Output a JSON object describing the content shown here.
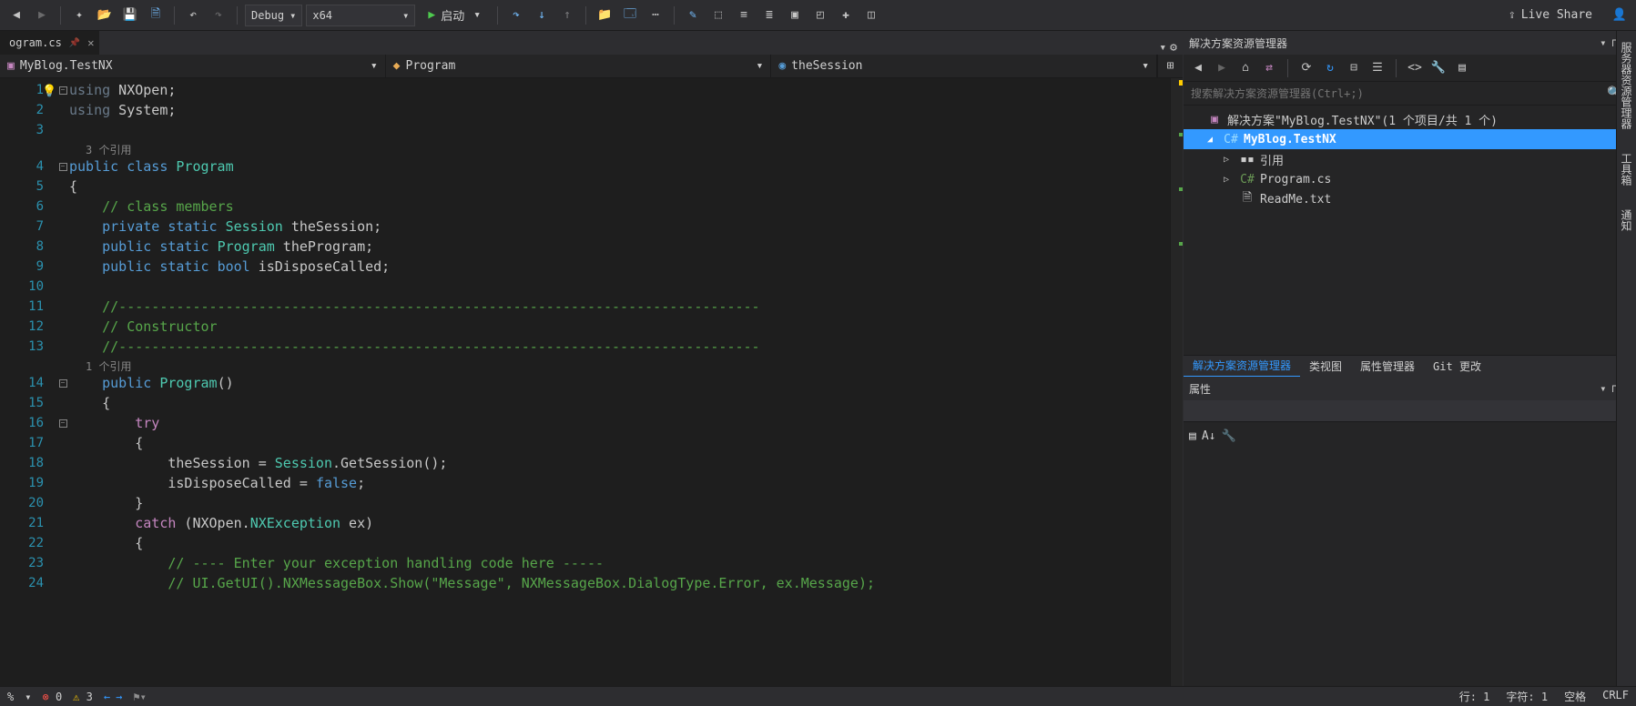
{
  "toolbar": {
    "config": "Debug",
    "platform": "x64",
    "start": "启动",
    "liveshare": "Live Share"
  },
  "tab": {
    "name": "ogram.cs"
  },
  "nav": {
    "project": "MyBlog.TestNX",
    "class": "Program",
    "member": "theSession"
  },
  "codelens": {
    "refs3": "3 个引用",
    "refs1": "1 个引用"
  },
  "code": {
    "l1_using": "using",
    "l1_nxopen": " NXOpen;",
    "l2_using": "using",
    "l2_system": " System;",
    "l4": "public class ",
    "l4_prog": "Program",
    "l5": "{",
    "l6": "    // class members",
    "l7_a": "    private static ",
    "l7_b": "Session",
    "l7_c": " theSession;",
    "l8_a": "    public static ",
    "l8_b": "Program",
    "l8_c": " theProgram;",
    "l9_a": "    public static ",
    "l9_b": "bool",
    "l9_c": " isDisposeCalled;",
    "l11": "    //------------------------------------------------------------------------------",
    "l12": "    // Constructor",
    "l13": "    //------------------------------------------------------------------------------",
    "l14_a": "    public ",
    "l14_b": "Program",
    "l14_c": "()",
    "l15": "    {",
    "l16_a": "        try",
    "l17": "        {",
    "l18_a": "            theSession = ",
    "l18_b": "Session",
    "l18_c": ".GetSession();",
    "l19_a": "            isDisposeCalled = ",
    "l19_b": "false",
    "l19_c": ";",
    "l20": "        }",
    "l21_a": "        catch",
    "l21_b": " (NXOpen.",
    "l21_c": "NXException",
    "l21_d": " ex)",
    "l22": "        {",
    "l23": "            // ---- Enter your exception handling code here -----",
    "l24": "            // UI.GetUI().NXMessageBox.Show(\"Message\", NXMessageBox.DialogType.Error, ex.Message);"
  },
  "solutionExplorer": {
    "title": "解决方案资源管理器",
    "searchPlaceholder": "搜索解决方案资源管理器(Ctrl+;)",
    "solution": "解决方案\"MyBlog.TestNX\"(1 个项目/共 1 个)",
    "project": "MyBlog.TestNX",
    "references": "引用",
    "file1": "Program.cs",
    "file2": "ReadMe.txt",
    "tabs": {
      "se": "解决方案资源管理器",
      "cv": "类视图",
      "pm": "属性管理器",
      "git": "Git 更改"
    }
  },
  "properties": {
    "title": "属性"
  },
  "sideTabs": {
    "a": "服务器资源管理器",
    "b": "工具箱",
    "c": "通知"
  },
  "status": {
    "pct": "%",
    "errors": "0",
    "warnings": "3",
    "line": "行: 1",
    "col": "字符: 1",
    "spaces": "空格",
    "crlf": "CRLF"
  }
}
